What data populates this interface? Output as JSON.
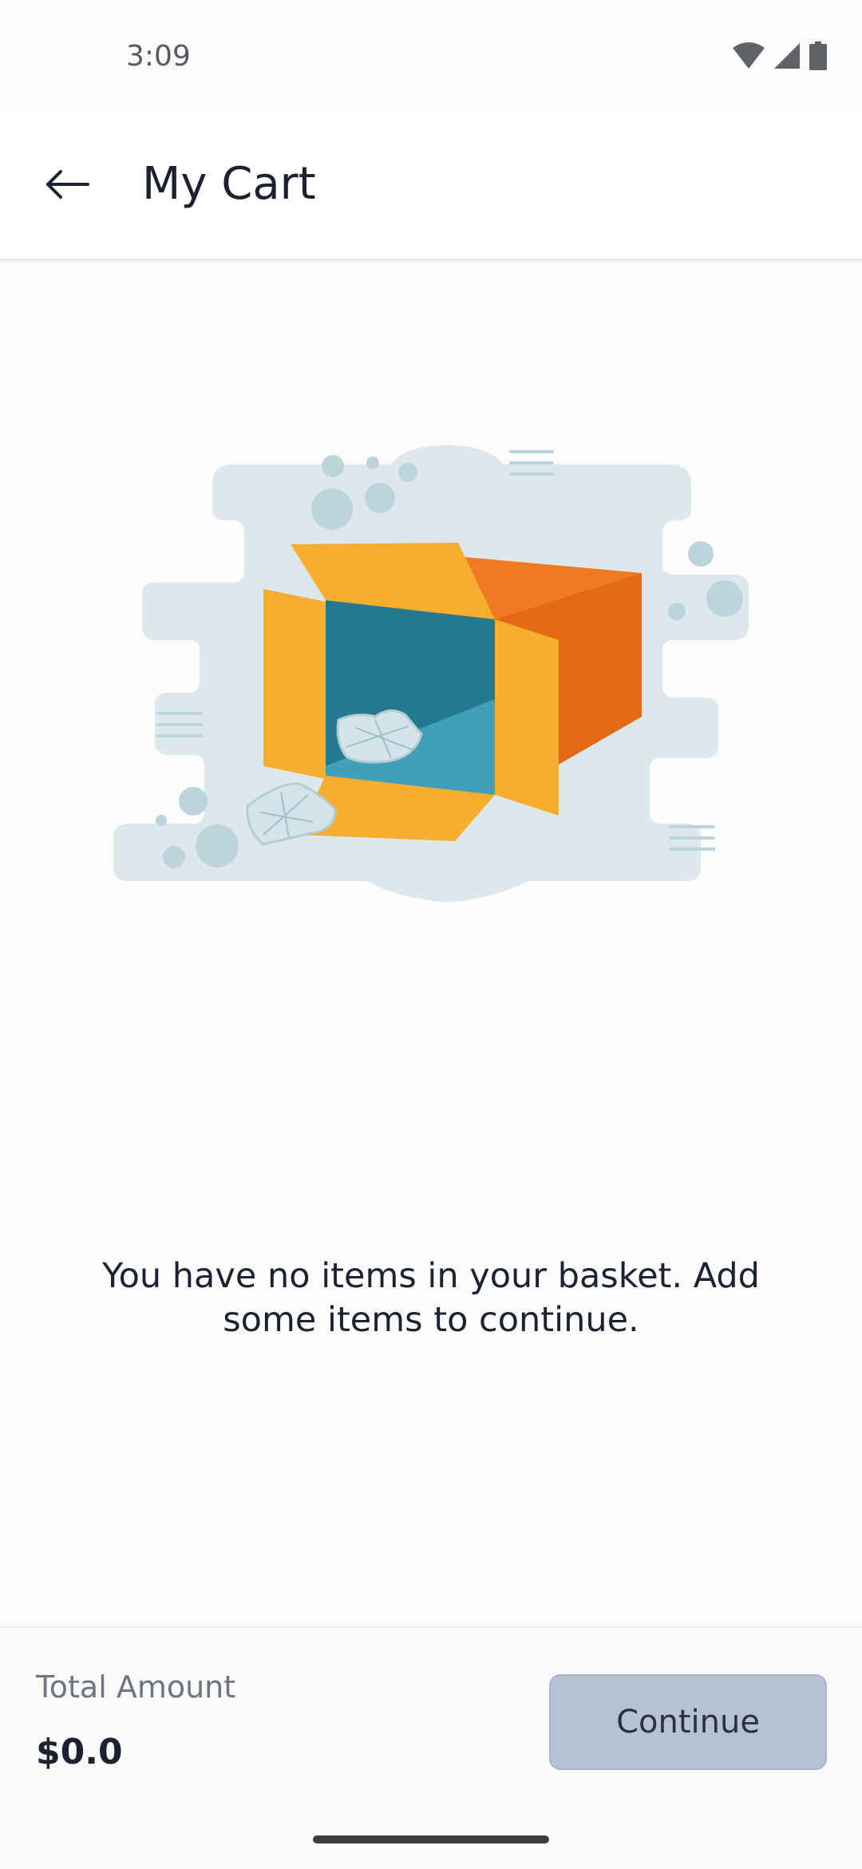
{
  "status_bar": {
    "time": "3:09",
    "icons": [
      "wifi-icon",
      "cellular-signal-icon",
      "battery-icon"
    ]
  },
  "header": {
    "back_icon": "arrow-left-icon",
    "title": "My Cart"
  },
  "empty_state": {
    "illustration": "open-box-empty-cart-illustration",
    "message": "You have no items in your basket. Add some items to continue."
  },
  "footer": {
    "total_label": "Total Amount",
    "total_value": "$0.0",
    "continue_label": "Continue"
  },
  "colors": {
    "background": "#fdfcfc",
    "text_primary": "#1b2333",
    "text_secondary": "#6e7582",
    "button_disabled": "#b6c2d3",
    "box_yellow": "#f7ad2e",
    "box_orange": "#e26a16",
    "box_teal": "#25798f",
    "blob": "#dde8ec"
  }
}
